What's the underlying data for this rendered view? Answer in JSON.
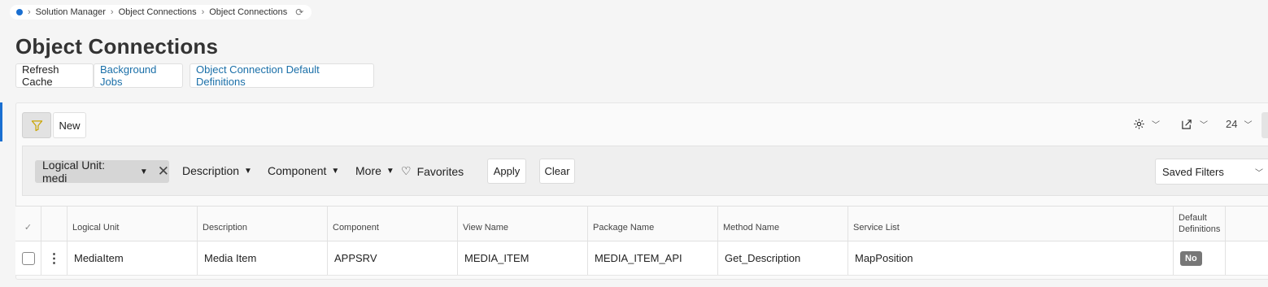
{
  "breadcrumb": {
    "items": [
      "Solution Manager",
      "Object Connections",
      "Object Connections"
    ]
  },
  "page": {
    "title": "Object Connections"
  },
  "commands": {
    "refresh_cache": "Refresh Cache",
    "background_jobs": "Background Jobs",
    "default_definitions": "Object Connection Default Definitions"
  },
  "toolbar": {
    "new_label": "New",
    "page_size": "24"
  },
  "filters": {
    "chip_label": "Logical Unit: medi",
    "description": "Description",
    "component": "Component",
    "more": "More",
    "favorites": "Favorites",
    "apply": "Apply",
    "clear": "Clear",
    "saved_filters": "Saved Filters"
  },
  "table": {
    "columns": {
      "logical_unit": "Logical Unit",
      "description": "Description",
      "component": "Component",
      "view_name": "View Name",
      "package_name": "Package Name",
      "method_name": "Method Name",
      "service_list": "Service List",
      "default_definitions_1": "Default",
      "default_definitions_2": "Definitions"
    },
    "rows": [
      {
        "logical_unit": "MediaItem",
        "description": "Media Item",
        "component": "APPSRV",
        "view_name": "MEDIA_ITEM",
        "package_name": "MEDIA_ITEM_API",
        "method_name": "Get_Description",
        "service_list": "MapPosition",
        "default_definitions": "No"
      }
    ]
  },
  "colors": {
    "accent": "#1a6fd1",
    "link": "#1a6fa8",
    "badge": "#777777"
  },
  "icons": [
    "filter-icon",
    "gear-icon",
    "export-icon",
    "chevron-down-icon",
    "heart-icon",
    "close-icon",
    "refresh-icon",
    "kebab-icon"
  ]
}
